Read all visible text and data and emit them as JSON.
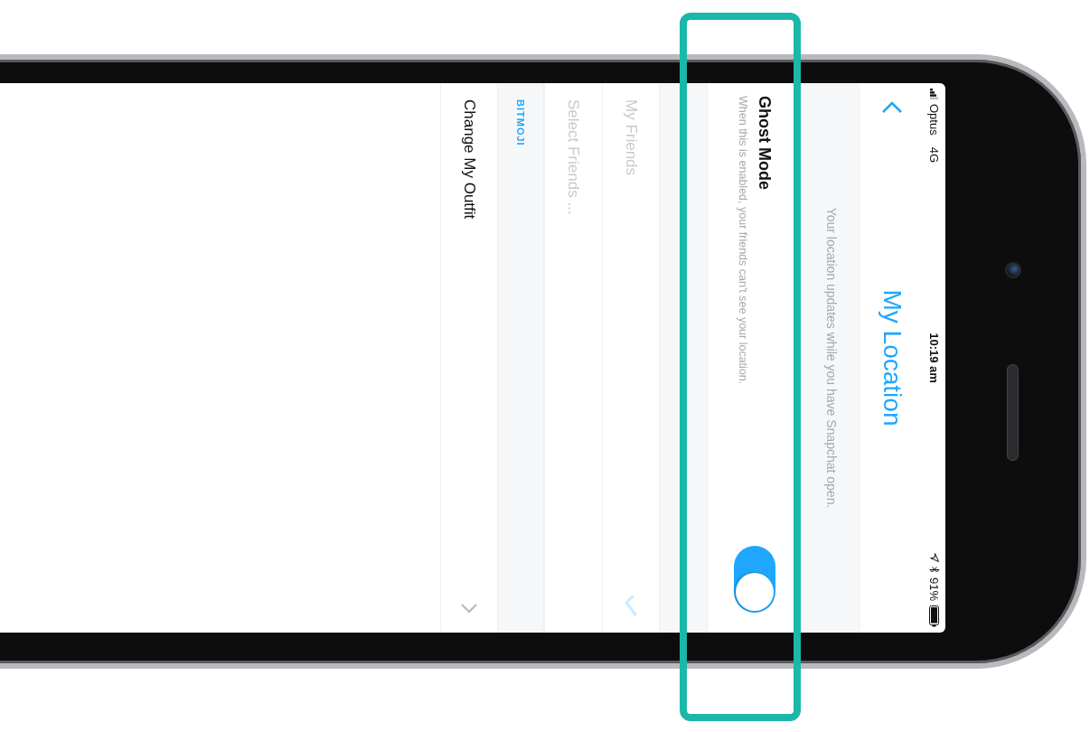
{
  "status_bar": {
    "carrier": "Optus",
    "network": "4G",
    "time": "10:19 am",
    "battery": "91%"
  },
  "header": {
    "title": "My Location"
  },
  "description": "Your location updates while you have Snapchat open.",
  "ghost_mode": {
    "title": "Ghost Mode",
    "subtitle": "When this is enabled, your friends can't see your location.",
    "on": true
  },
  "location_options": [
    {
      "label": "My Friends",
      "selected": true,
      "disabled": true
    },
    {
      "label": "Select Friends ...",
      "selected": false,
      "disabled": true
    }
  ],
  "bitmoji": {
    "header": "BITMOJI",
    "items": [
      {
        "label": "Change My Outfit",
        "expanded": false
      }
    ]
  }
}
